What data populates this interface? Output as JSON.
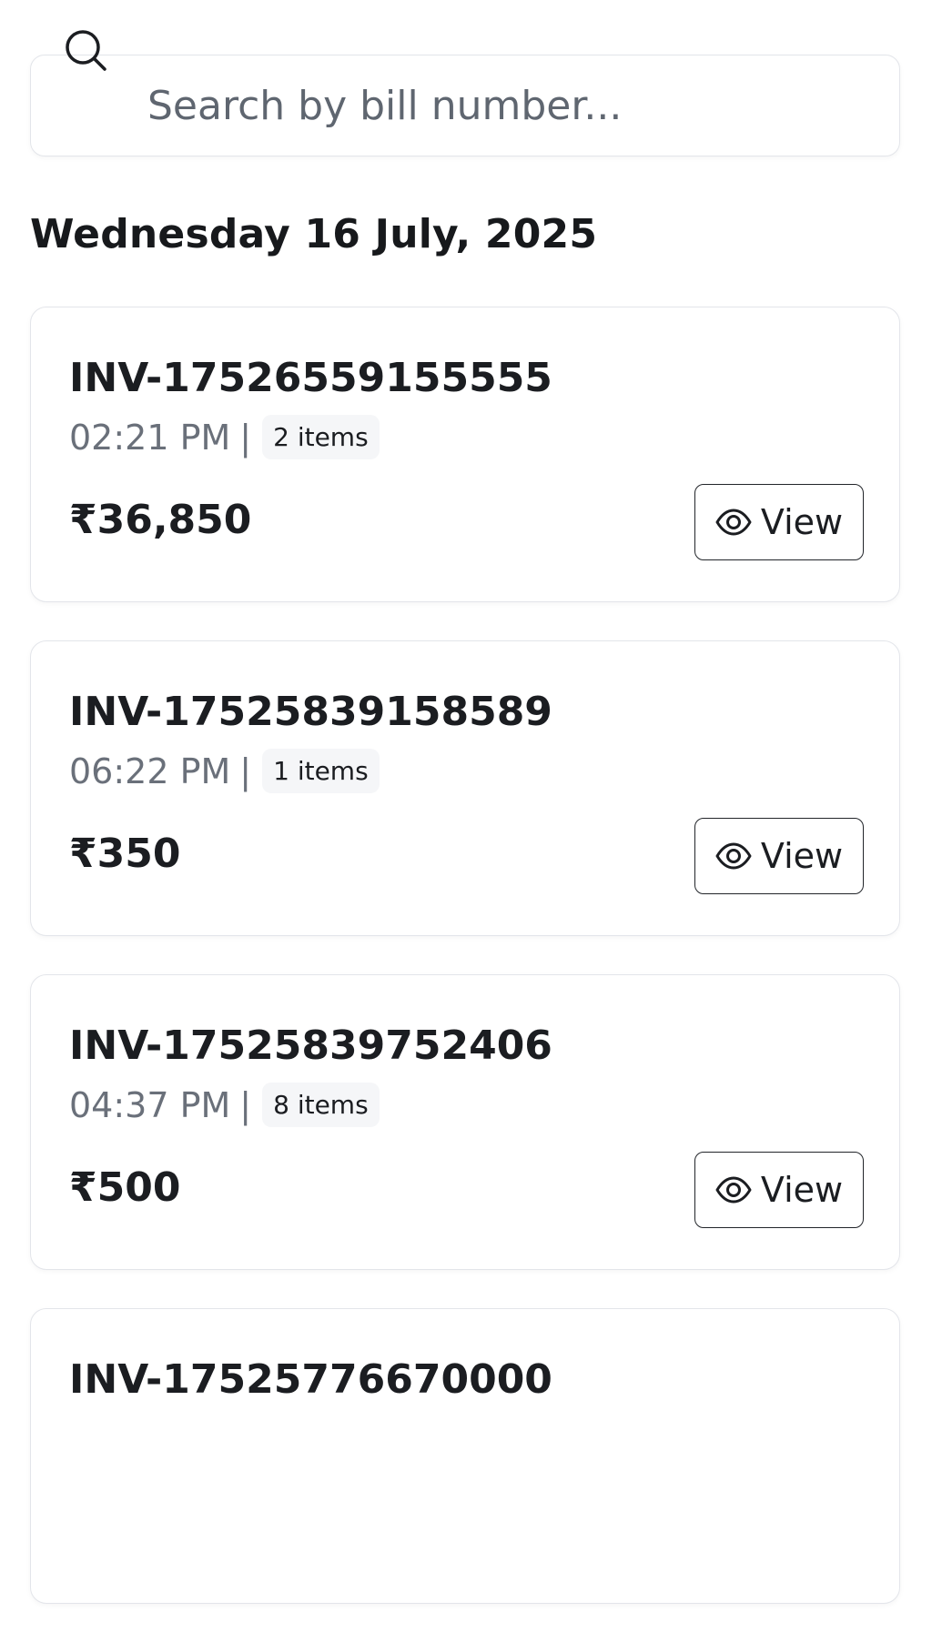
{
  "search": {
    "placeholder": "Search by bill number...",
    "icon": "search-icon"
  },
  "date_heading": "Wednesday 16 July, 2025",
  "bills": [
    {
      "number": "INV-17526559155555",
      "time": "02:21 PM",
      "separator": "|",
      "items": "2 items",
      "amount": "₹36,850",
      "view_label": "View"
    },
    {
      "number": "INV-17525839158589",
      "time": "06:22 PM",
      "separator": "|",
      "items": "1 items",
      "amount": "₹350",
      "view_label": "View"
    },
    {
      "number": "INV-17525839752406",
      "time": "04:37 PM",
      "separator": "|",
      "items": "8 items",
      "amount": "₹500",
      "view_label": "View"
    },
    {
      "number": "INV-17525776670000",
      "time": "",
      "separator": "",
      "items": "",
      "amount": "",
      "view_label": ""
    }
  ],
  "colors": {
    "border": "#e3e5ea",
    "text_primary": "#1b1d21",
    "text_secondary": "#6a707a",
    "badge_bg": "#f5f6f8"
  }
}
